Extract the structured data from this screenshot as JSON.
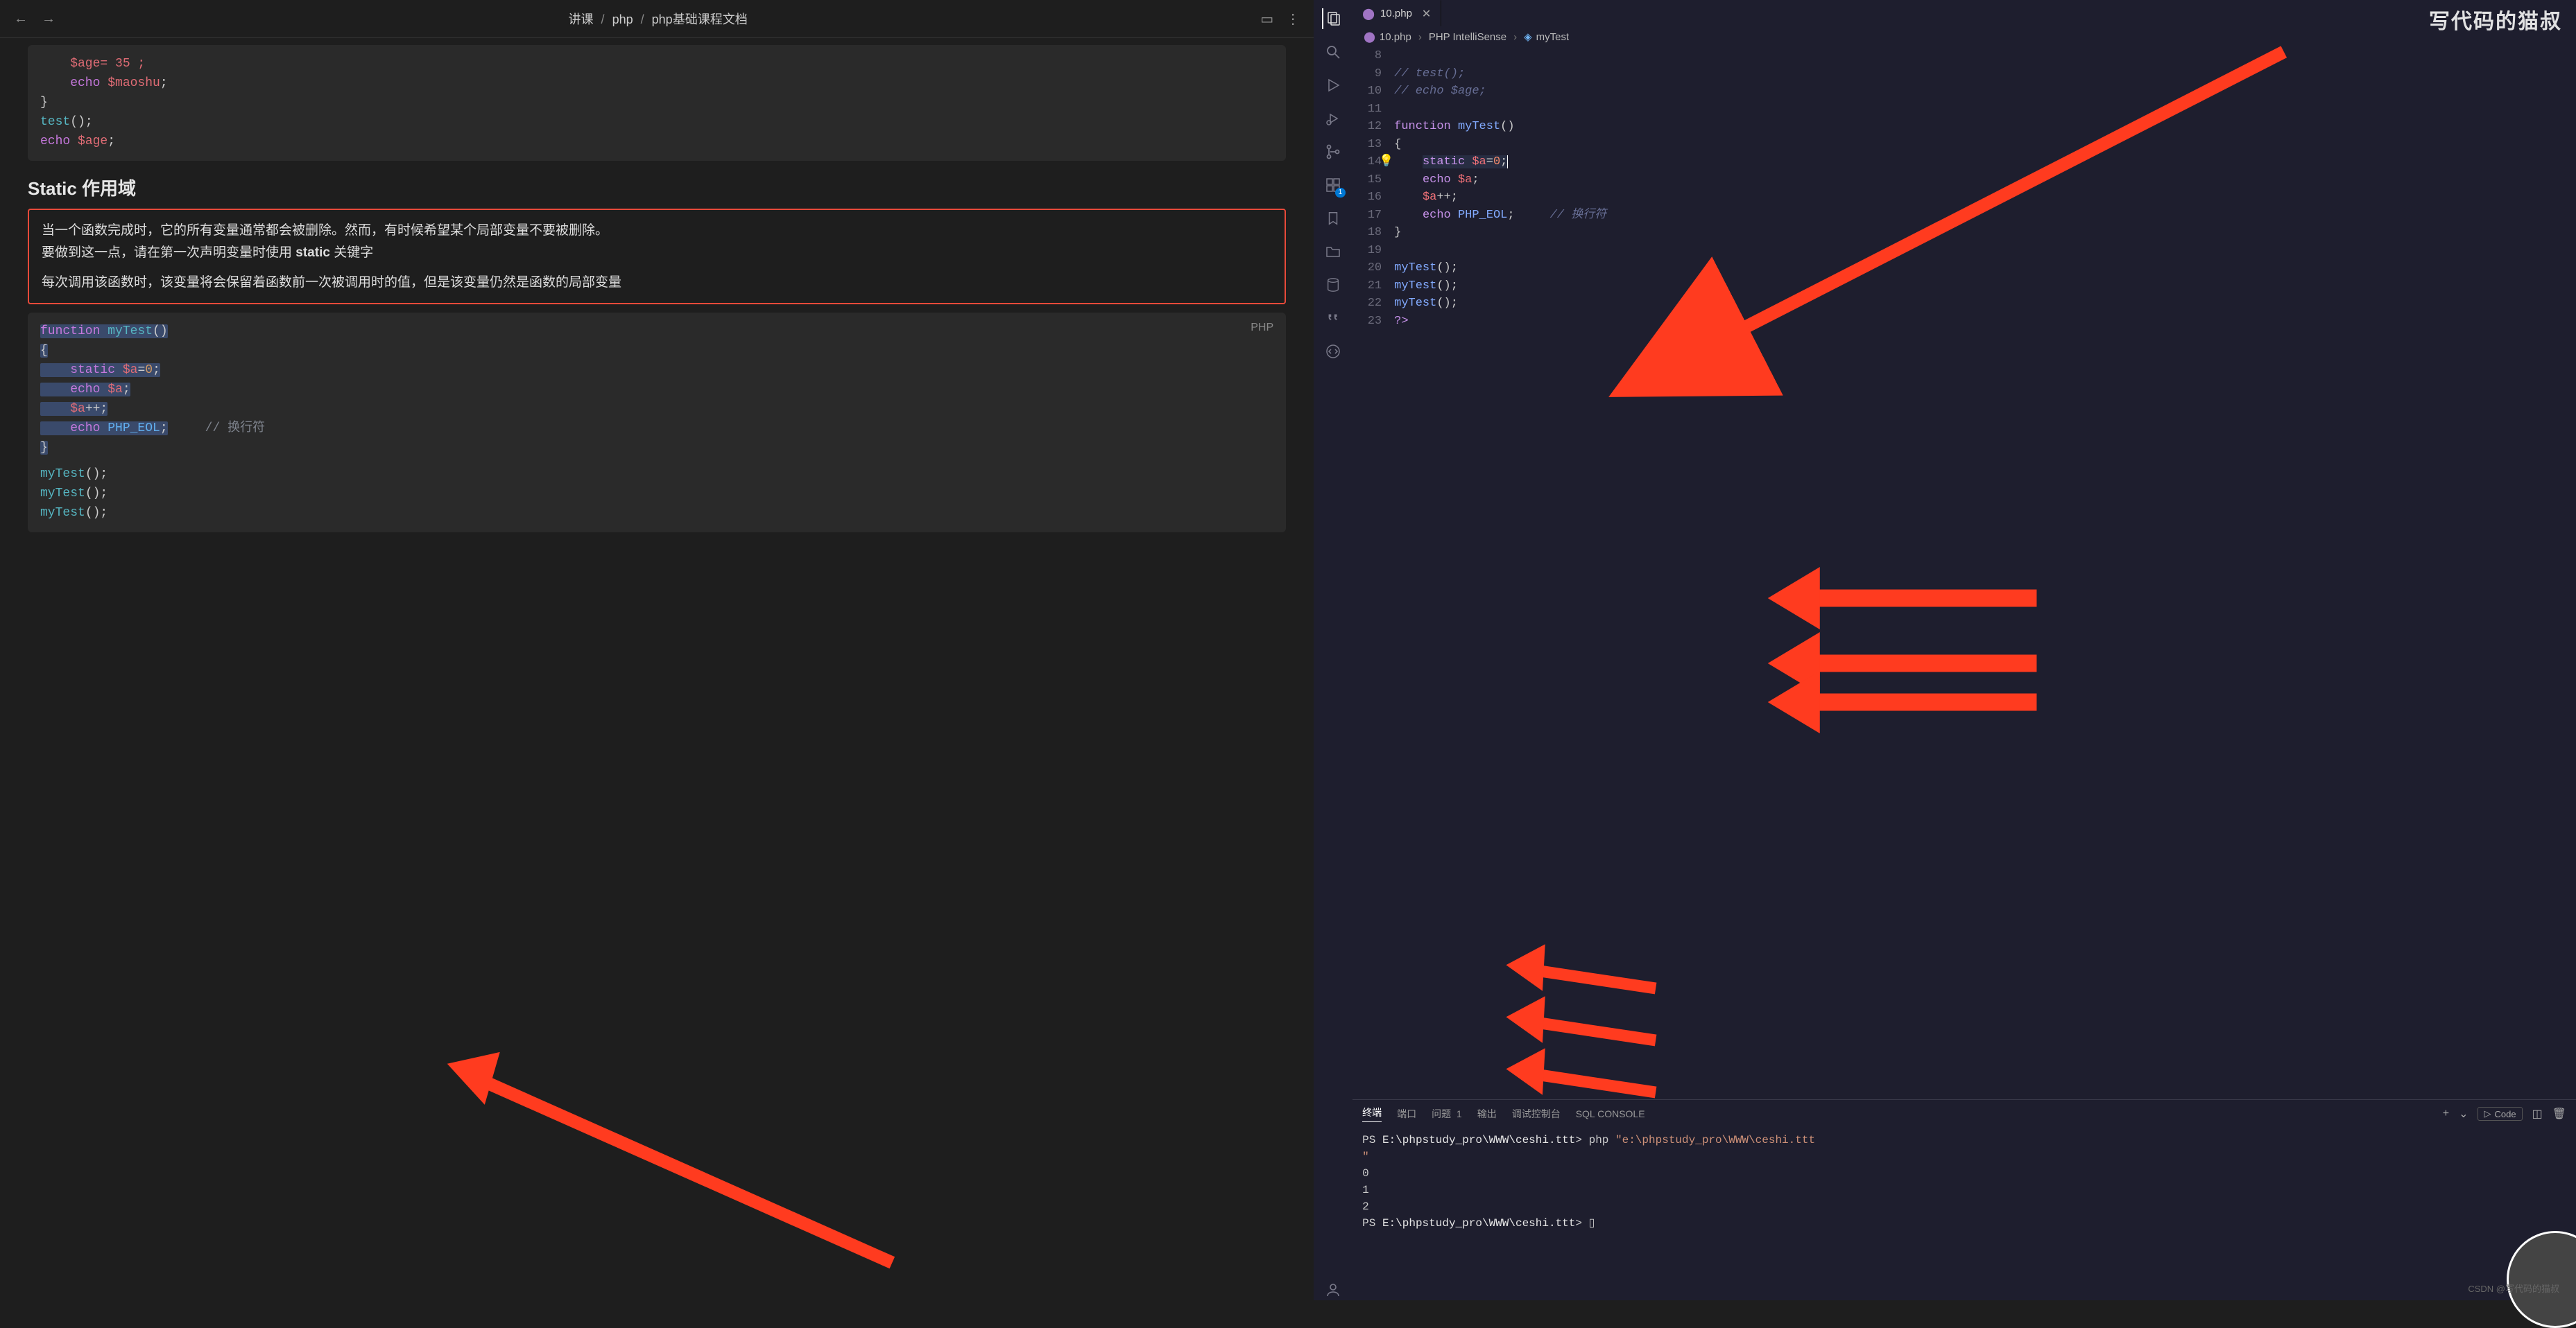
{
  "watermark": "写代码的猫叔",
  "csdn": "CSDN @写代码的猫叔",
  "doc": {
    "breadcrumb": [
      "讲课",
      "php",
      "php基础课程文档"
    ],
    "code_top": {
      "l1": "    $age= 35 ;",
      "l2": "    echo $maoshu;",
      "l3": "}",
      "l4": "test();",
      "l5": "echo $age;"
    },
    "section_title": "Static 作用域",
    "callout_p1": "当一个函数完成时，它的所有变量通常都会被删除。然而，有时候希望某个局部变量不要被删除。",
    "callout_p2a": "要做到这一点，请在第一次声明变量时使用 ",
    "callout_p2b": "static",
    "callout_p2c": " 关键字",
    "callout_p3": "每次调用该函数时，该变量将会保留着函数前一次被调用时的值，但是该变量仍然是函数的局部变量",
    "code_bottom": {
      "lang": "PHP",
      "l1_kw": "function",
      "l1_fn": " myTest",
      "l1_rest": "()",
      "l2": "{",
      "l3_kw": "    static ",
      "l3_var": "$a",
      "l3_eq": "=",
      "l3_num": "0",
      "l3_semi": ";",
      "l4_echo": "    echo ",
      "l4_var": "$a",
      "l4_semi": ";",
      "l5_var": "    $a",
      "l5_op": "++",
      "l5_semi": ";",
      "l6_echo": "    echo ",
      "l6_const": "PHP_EOL",
      "l6_semi": ";",
      "l6_cm": "     // 换行符",
      "l7": "}",
      "l8": "myTest();",
      "l9": "myTest();",
      "l10": "myTest();"
    }
  },
  "vscode": {
    "tab_name": "10.php",
    "breadcrumb": {
      "file": "10.php",
      "provider": "PHP IntelliSense",
      "symbol": "myTest"
    },
    "activity_badge": "1",
    "gutter": [
      "8",
      "9",
      "10",
      "11",
      "12",
      "13",
      "14",
      "15",
      "16",
      "17",
      "18",
      "19",
      "20",
      "21",
      "22",
      "23"
    ],
    "lines": {
      "l9": "// test();",
      "l10": "// echo $age;",
      "l11": "",
      "l12_kw": "function",
      "l12_fn": " myTest",
      "l12_rest": "()",
      "l13": "{",
      "l14a": "    ",
      "l14_kw": "static",
      "l14_sp": " ",
      "l14_var": "$a",
      "l14_eq": "=",
      "l14_num": "0",
      "l14_semi": ";",
      "l15a": "    ",
      "l15_echo": "echo",
      "l15_sp": " ",
      "l15_var": "$a",
      "l15_semi": ";",
      "l16a": "    ",
      "l16_var": "$a",
      "l16_op": "++",
      "l16_semi": ";",
      "l17a": "    ",
      "l17_echo": "echo",
      "l17_sp": " ",
      "l17_const": "PHP_EOL",
      "l17_semi": ";",
      "l17_cmpad": "     ",
      "l17_cm": "// 换行符",
      "l18": "}",
      "l19": "",
      "l20": "myTest();",
      "l21": "myTest();",
      "l22": "myTest();",
      "l23": "?>"
    },
    "panel": {
      "tabs": {
        "terminal": "终端",
        "ports": "端口",
        "problems": "问题",
        "problems_count": "1",
        "output": "输出",
        "debug": "调试控制台",
        "sql": "SQL CONSOLE"
      },
      "tools_code": "Code",
      "terminal": {
        "line1_prompt": "PS ",
        "line1_path": "E:\\phpstudy_pro\\WWW\\ceshi.ttt",
        "line1_gt": "> ",
        "line1_cmd": "php ",
        "line1_arg": "\"e:\\phpstudy_pro\\WWW\\ceshi.ttt",
        "line1q": "\"",
        "out0": "0",
        "out1": "1",
        "out2": "2",
        "line2_prompt": "PS ",
        "line2_path": "E:\\phpstudy_pro\\WWW\\ceshi.ttt",
        "line2_gt": "> "
      }
    }
  }
}
